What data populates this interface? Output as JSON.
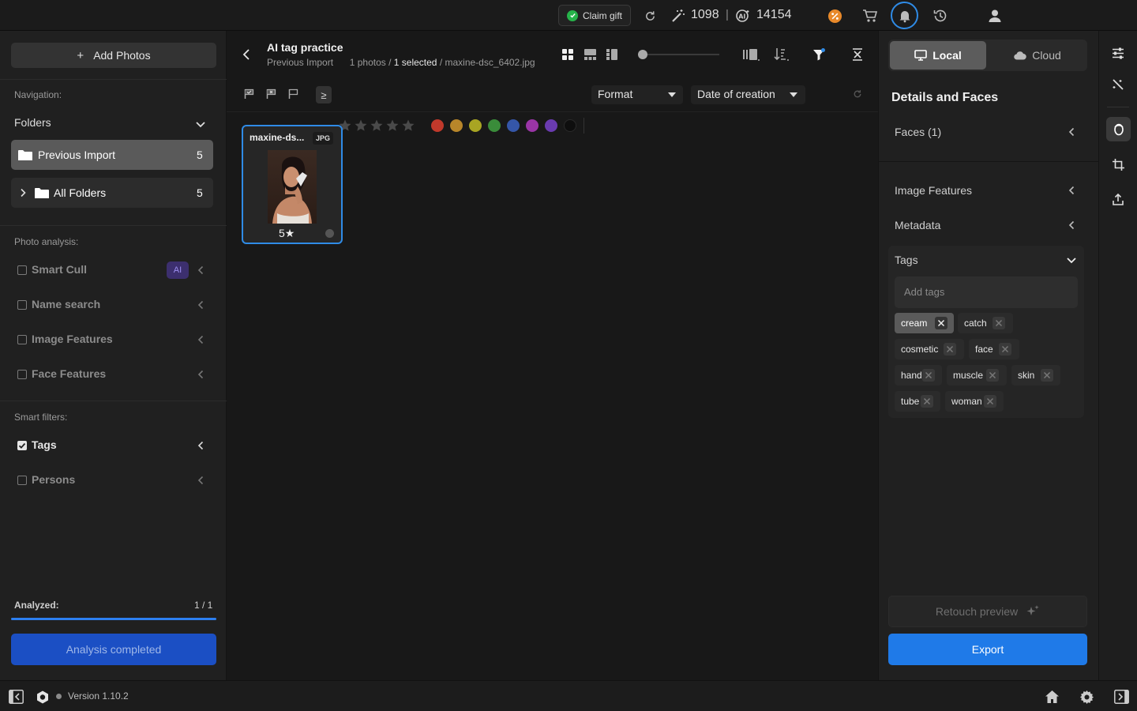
{
  "topbar": {
    "claim_gift": "Claim gift",
    "credits_1": "1098",
    "credits_sep": "|",
    "credits_2": "14154"
  },
  "left": {
    "add_photos": "Add Photos",
    "navigation_label": "Navigation:",
    "folders_label": "Folders",
    "folders": [
      {
        "name": "Previous Import",
        "count": "5"
      },
      {
        "name": "All Folders",
        "count": "5"
      }
    ],
    "photo_analysis_label": "Photo analysis:",
    "analysis_items": [
      {
        "label": "Smart Cull",
        "badge": "AI"
      },
      {
        "label": "Name search"
      },
      {
        "label": "Image Features"
      },
      {
        "label": "Face Features"
      }
    ],
    "smart_filters_label": "Smart filters:",
    "smart_filters": [
      {
        "label": "Tags",
        "checked": true
      },
      {
        "label": "Persons",
        "checked": false
      }
    ],
    "analyzed_label": "Analyzed:",
    "analyzed_count": "1 / 1",
    "analyzed_progress": 1.0,
    "analysis_button": "Analysis completed"
  },
  "center": {
    "title": "AI tag practice",
    "crumb_folder": "Previous Import",
    "crumb_photos": "1 photos /",
    "crumb_selected": "1 selected",
    "crumb_file": "/ maxine-dsc_6402.jpg",
    "rating_operator": "≥",
    "color_labels": [
      "#c0392b",
      "#b8862a",
      "#a9a523",
      "#3a8c3a",
      "#3556a8",
      "#9a35a6",
      "#6a3bb0",
      "#0e0e0e"
    ],
    "format_dropdown": "Format",
    "sort_dropdown": "Date of creation",
    "photo": {
      "name": "maxine-ds...",
      "format": "JPG",
      "rating": "5★"
    }
  },
  "right": {
    "local_tab": "Local",
    "cloud_tab": "Cloud",
    "details_title": "Details and Faces",
    "faces": "Faces (1)",
    "image_features": "Image Features",
    "metadata": "Metadata",
    "tags_title": "Tags",
    "add_tags_placeholder": "Add tags",
    "tags": [
      "cream",
      "catch",
      "cosmetic",
      "face",
      "hand",
      "muscle",
      "skin",
      "tube",
      "woman"
    ],
    "retouch_preview": "Retouch preview",
    "export": "Export"
  },
  "bottom": {
    "version": "Version 1.10.2"
  }
}
